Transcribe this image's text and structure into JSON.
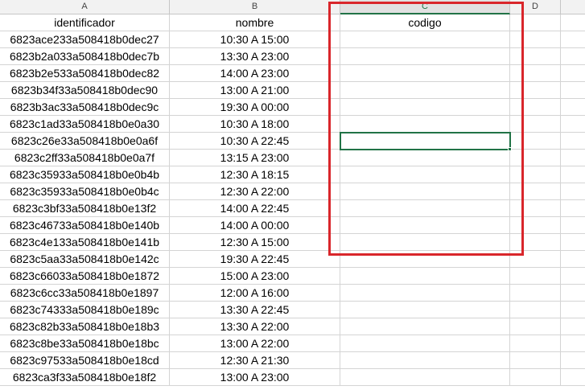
{
  "columns": [
    "A",
    "B",
    "C",
    "D"
  ],
  "headers": {
    "a": "identificador",
    "b": "nombre",
    "c": "codigo"
  },
  "rows": [
    {
      "id": "6823ace233a508418b0dec27",
      "nombre": "10:30 A 15:00"
    },
    {
      "id": "6823b2a033a508418b0dec7b",
      "nombre": "13:30 A 23:00"
    },
    {
      "id": "6823b2e533a508418b0dec82",
      "nombre": "14:00 A 23:00"
    },
    {
      "id": "6823b34f33a508418b0dec90",
      "nombre": "13:00 A 21:00"
    },
    {
      "id": "6823b3ac33a508418b0dec9c",
      "nombre": "19:30 A 00:00"
    },
    {
      "id": "6823c1ad33a508418b0e0a30",
      "nombre": "10:30 A 18:00"
    },
    {
      "id": "6823c26e33a508418b0e0a6f",
      "nombre": "10:30 A 22:45"
    },
    {
      "id": "6823c2ff33a508418b0e0a7f",
      "nombre": "13:15 A 23:00"
    },
    {
      "id": "6823c35933a508418b0e0b4b",
      "nombre": "12:30 A 18:15"
    },
    {
      "id": "6823c35933a508418b0e0b4c",
      "nombre": "12:30 A 22:00"
    },
    {
      "id": "6823c3bf33a508418b0e13f2",
      "nombre": "14:00 A 22:45"
    },
    {
      "id": "6823c46733a508418b0e140b",
      "nombre": "14:00 A 00:00"
    },
    {
      "id": "6823c4e133a508418b0e141b",
      "nombre": "12:30 A 15:00"
    },
    {
      "id": "6823c5aa33a508418b0e142c",
      "nombre": "19:30 A 22:45"
    },
    {
      "id": "6823c66033a508418b0e1872",
      "nombre": "15:00 A 23:00"
    },
    {
      "id": "6823c6cc33a508418b0e1897",
      "nombre": "12:00 A 16:00"
    },
    {
      "id": "6823c74333a508418b0e189c",
      "nombre": "13:30 A 22:45"
    },
    {
      "id": "6823c82b33a508418b0e18b3",
      "nombre": "13:30 A 22:00"
    },
    {
      "id": "6823c8be33a508418b0e18bc",
      "nombre": "13:00 A 22:00"
    },
    {
      "id": "6823c97533a508418b0e18cd",
      "nombre": "12:30 A 21:30"
    },
    {
      "id": "6823ca3f33a508418b0e18f2",
      "nombre": "13:00 A 23:00"
    }
  ],
  "colors": {
    "selection_green": "#217346",
    "highlight_red": "#d9262b",
    "header_bg": "#f2f2f2",
    "gridline": "#d4d4d4"
  }
}
